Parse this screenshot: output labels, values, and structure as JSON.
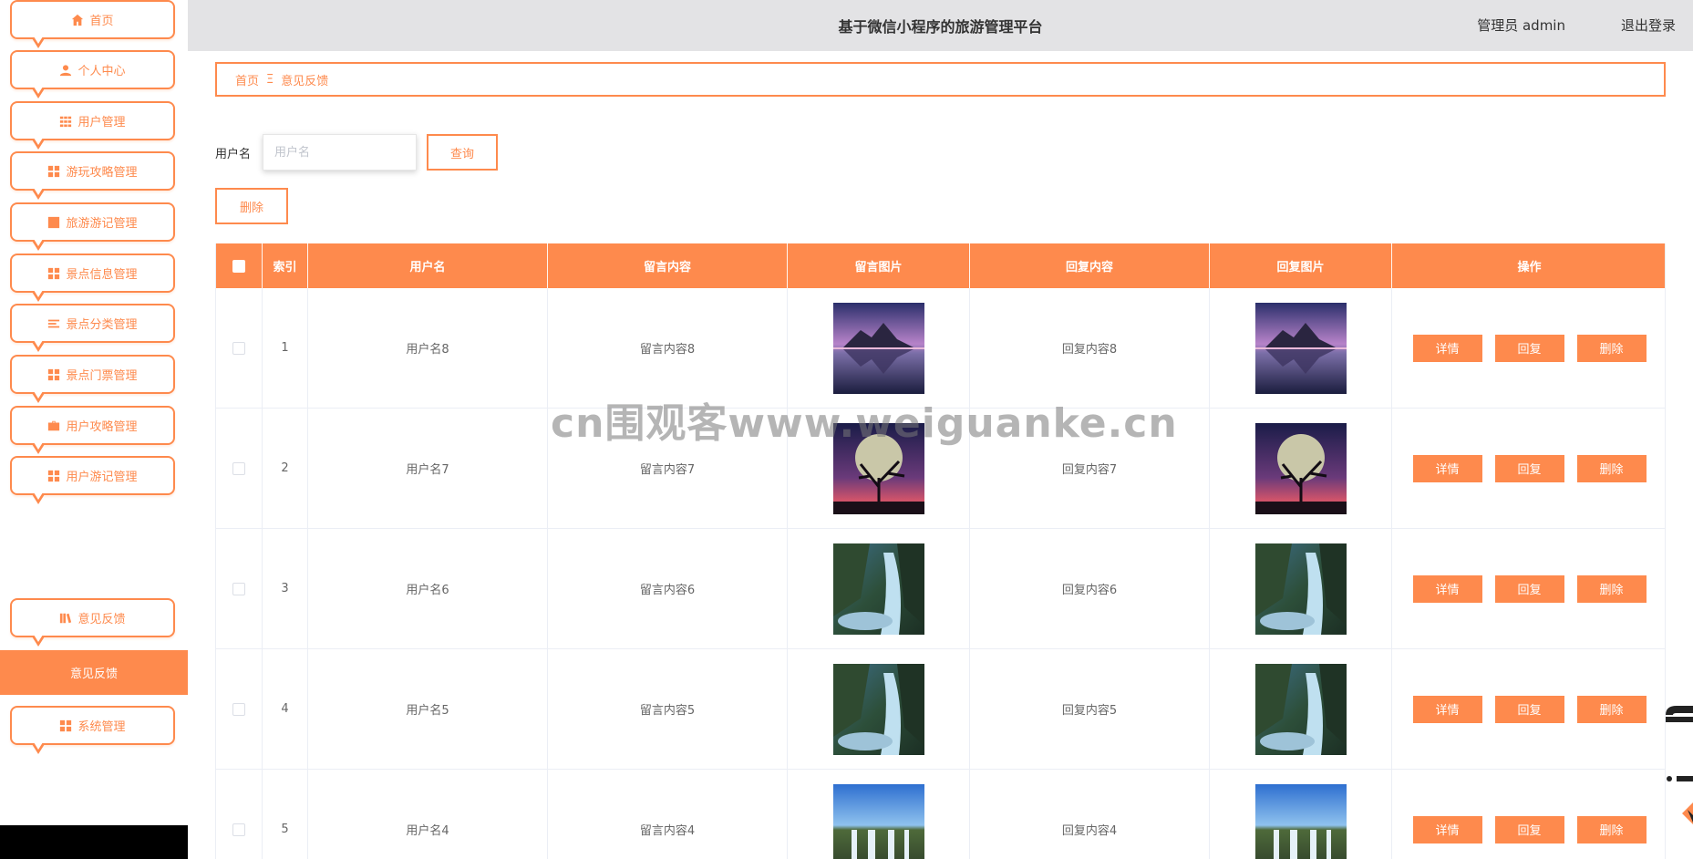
{
  "header": {
    "title": "基于微信小程序的旅游管理平台",
    "admin_label": "管理员 admin",
    "logout_label": "退出登录"
  },
  "sidebar": {
    "items": [
      {
        "label": "首页",
        "icon": "home-icon"
      },
      {
        "label": "个人中心",
        "icon": "user-icon"
      },
      {
        "label": "用户管理",
        "icon": "grid-icon"
      },
      {
        "label": "游玩攻略管理",
        "icon": "apps-icon"
      },
      {
        "label": "旅游游记管理",
        "icon": "chart-icon"
      },
      {
        "label": "景点信息管理",
        "icon": "apps-icon"
      },
      {
        "label": "景点分类管理",
        "icon": "list-icon"
      },
      {
        "label": "景点门票管理",
        "icon": "apps-icon"
      },
      {
        "label": "用户攻略管理",
        "icon": "briefcase-icon"
      },
      {
        "label": "用户游记管理",
        "icon": "apps-icon"
      },
      {
        "label": "意见反馈",
        "icon": "book-icon"
      },
      {
        "label": "系统管理",
        "icon": "apps-icon"
      }
    ],
    "active_submenu": "意见反馈"
  },
  "breadcrumb": {
    "home": "首页",
    "separator": "Ξ",
    "current": "意见反馈"
  },
  "search": {
    "label": "用户名",
    "placeholder": "用户名",
    "value": "",
    "query_button": "查询",
    "delete_button": "删除"
  },
  "table": {
    "columns": [
      "索引",
      "用户名",
      "留言内容",
      "留言图片",
      "回复内容",
      "回复图片",
      "操作"
    ],
    "rows": [
      {
        "index": "1",
        "username": "用户名8",
        "message": "留言内容8",
        "reply": "回复内容8",
        "image": "mountain-lake"
      },
      {
        "index": "2",
        "username": "用户名7",
        "message": "留言内容7",
        "reply": "回复内容7",
        "image": "moon-tree"
      },
      {
        "index": "3",
        "username": "用户名6",
        "message": "留言内容6",
        "reply": "回复内容6",
        "image": "waterfall"
      },
      {
        "index": "4",
        "username": "用户名5",
        "message": "留言内容5",
        "reply": "回复内容5",
        "image": "waterfall"
      },
      {
        "index": "5",
        "username": "用户名4",
        "message": "留言内容4",
        "reply": "回复内容4",
        "image": "waterfall-wide"
      }
    ],
    "actions": {
      "detail": "详情",
      "reply": "回复",
      "delete": "删除"
    }
  },
  "watermark": "cn围观客www.weiguanke.cn",
  "colors": {
    "accent": "#fe8a4d",
    "header_bg": "#e3e3e5"
  }
}
